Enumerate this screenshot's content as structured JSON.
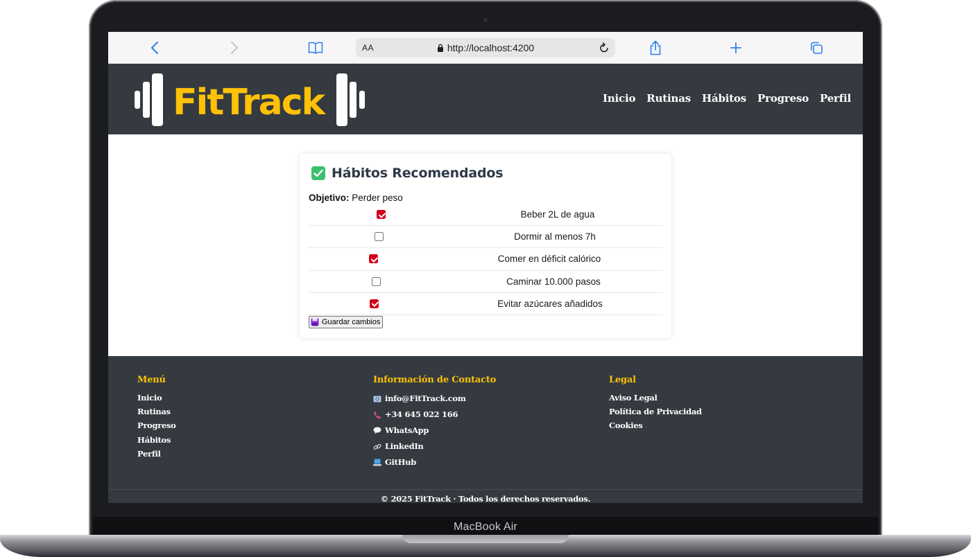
{
  "device": {
    "brand_label": "MacBook Air"
  },
  "browser": {
    "text_size_label": "AA",
    "url": "http://localhost:4200",
    "accent_color": "#2a7ef0"
  },
  "header": {
    "logo_text": "FitTrack",
    "nav": [
      "Inicio",
      "Rutinas",
      "Hábitos",
      "Progreso",
      "Perfil"
    ],
    "background_color": "#343a40",
    "brand_color": "#ffc107"
  },
  "habits_card": {
    "title": "Hábitos Recomendados",
    "objective_label": "Objetivo:",
    "objective_value": " Perder peso",
    "habits": [
      {
        "label": "Beber 2L de agua",
        "checked": true
      },
      {
        "label": "Dormir al menos 7h",
        "checked": false
      },
      {
        "label": "Comer en déficit calórico",
        "checked": true
      },
      {
        "label": "Caminar 10.000 pasos",
        "checked": false
      },
      {
        "label": "Evitar azúcares añadidos",
        "checked": true
      }
    ],
    "save_label": "Guardar cambios",
    "checkbox_color": "#d0021b"
  },
  "footer": {
    "menu": {
      "title": "Menú",
      "items": [
        "Inicio",
        "Rutinas",
        "Progreso",
        "Hábitos",
        "Perfil"
      ]
    },
    "contact": {
      "title": "Información de Contacto",
      "items": [
        {
          "icon": "email-icon",
          "text": "info@FitTrack.com"
        },
        {
          "icon": "phone-icon",
          "text": "+34 645 022 166"
        },
        {
          "icon": "speech-bubble-icon",
          "text": "WhatsApp"
        },
        {
          "icon": "link-icon",
          "text": "LinkedIn"
        },
        {
          "icon": "laptop-icon",
          "text": "GitHub"
        }
      ]
    },
    "legal": {
      "title": "Legal",
      "items": [
        "Aviso Legal",
        "Política de Privacidad",
        "Cookies"
      ]
    },
    "copyright": "© 2025 FitTrack · Todos los derechos reservados."
  }
}
